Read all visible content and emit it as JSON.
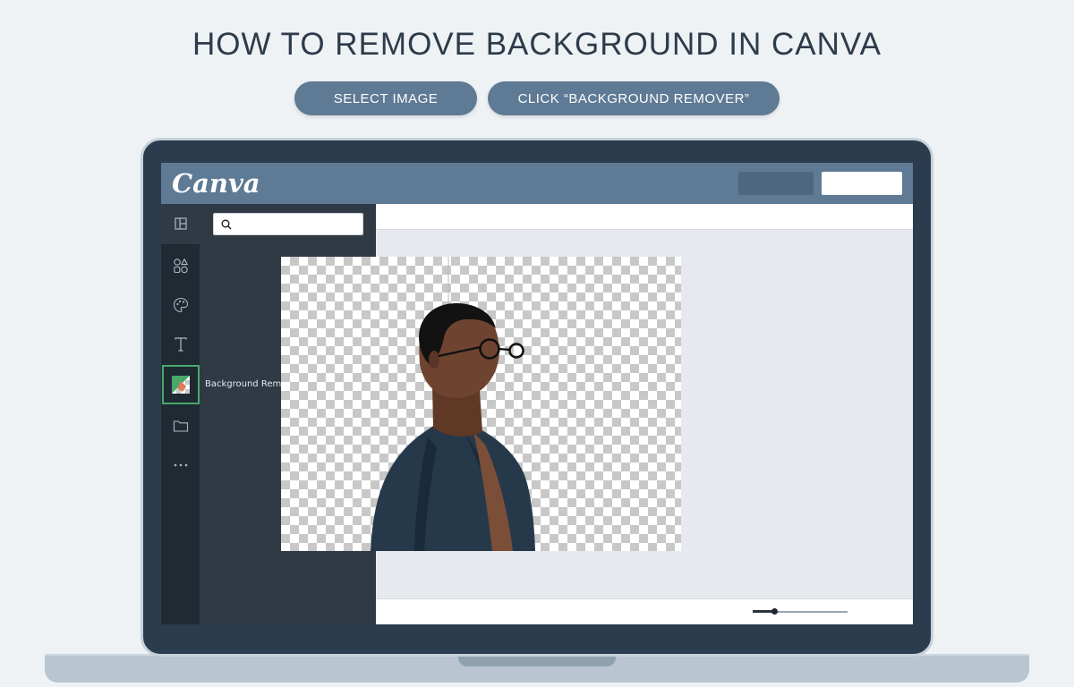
{
  "headline": "HOW TO REMOVE BACKGROUND IN CANVA",
  "steps": [
    {
      "label": "SELECT IMAGE"
    },
    {
      "label": "CLICK “BACKGROUND REMOVER”"
    }
  ],
  "app": {
    "logo": "Canva",
    "search": {
      "value": "",
      "placeholder": ""
    },
    "sidebar": {
      "items": [
        {
          "icon": "layout-icon",
          "active": false
        },
        {
          "icon": "elements-icon",
          "active": false
        },
        {
          "icon": "palette-icon",
          "active": false
        },
        {
          "icon": "text-icon",
          "active": false
        },
        {
          "icon": "background-remover-icon",
          "active": true,
          "label": "Background Remover"
        },
        {
          "icon": "folder-icon",
          "active": false
        },
        {
          "icon": "more-icon",
          "active": false
        }
      ]
    },
    "zoom": {
      "level": 0.2
    }
  },
  "colors": {
    "accent": "#5e7a94",
    "active_outline": "#4aa86a",
    "headline": "#2e3b4a"
  }
}
